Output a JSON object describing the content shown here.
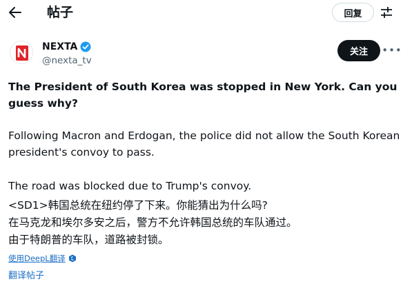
{
  "header": {
    "title": "帖子",
    "reply_label": "回复"
  },
  "author": {
    "name": "NEXTA",
    "handle": "@nexta_tv",
    "follow_label": "关注"
  },
  "post": {
    "title": "The President of South Korea was stopped in New York. Can you guess why?",
    "paragraph1": "Following Macron and Erdogan, the police did not allow the South Korean president's convoy to pass.",
    "paragraph2": "The road was blocked due to Trump's convoy.",
    "zh_line1": "<SD1>韩国总统在纽约停了下来。你能猜出为什么吗?",
    "zh_line2": "在马克龙和埃尔多安之后，警方不允许韩国总统的车队通过。",
    "zh_line3": "由于特朗普的车队，道路被封锁。"
  },
  "translation": {
    "deepl_label": "使用DeepL翻译",
    "translate_post_label": "翻译帖子"
  },
  "colors": {
    "accent": "#1d9bf0",
    "text": "#0f1419",
    "muted": "#536471",
    "link": "#1d6fc4",
    "nexta_red": "#e0242b"
  }
}
